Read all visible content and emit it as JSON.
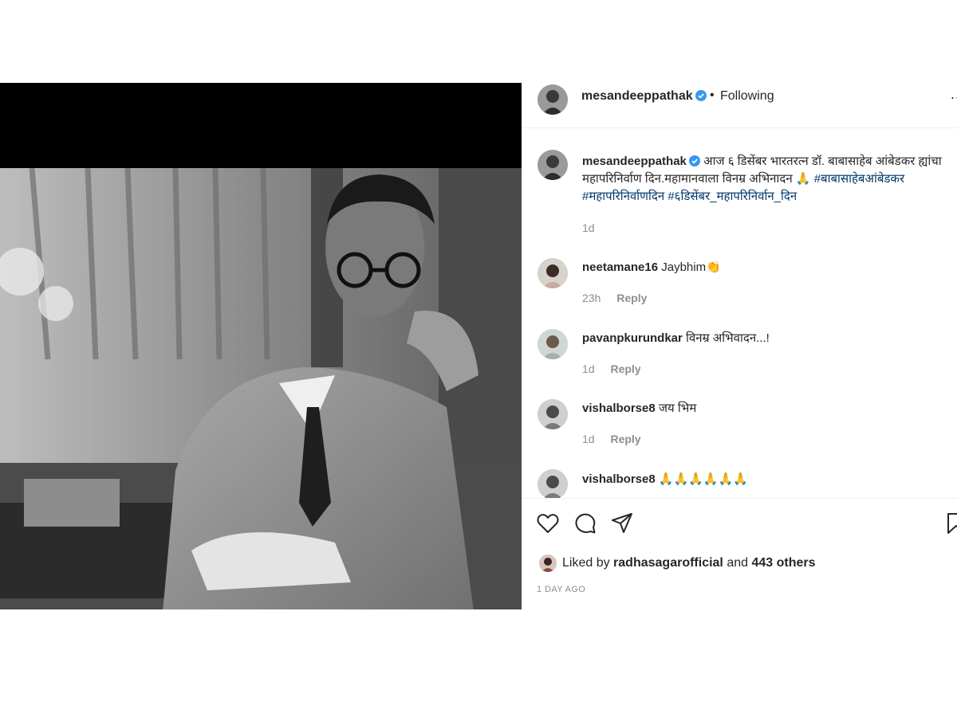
{
  "post": {
    "username": "mesandeeppathak",
    "follow_status": "Following",
    "separator": "•",
    "more_label": "..."
  },
  "caption": {
    "username": "mesandeeppathak",
    "text": "आज ६ डिसेंबर भारतरत्न डॉ. बाबासाहेब आंबेडकर ह्यांचा महापरिनिर्वाण दिन.महामानवाला विनम्र अभिनादन 🙏",
    "hashtags": "#बाबासाहेबआंबेडकर #महापरिनिर्वाणदिन #६डिसेंबर_महापरिनिर्वान_दिन",
    "time": "1d"
  },
  "comments": [
    {
      "username": "neetamane16",
      "text": "Jaybhim👏",
      "time": "23h",
      "reply_label": "Reply"
    },
    {
      "username": "pavanpkurundkar",
      "text": "विनम्र अभिवादन...!",
      "time": "1d",
      "reply_label": "Reply"
    },
    {
      "username": "vishalborse8",
      "text": "जय भिम",
      "time": "1d",
      "reply_label": "Reply"
    },
    {
      "username": "vishalborse8",
      "text": "🙏🙏🙏🙏🙏🙏",
      "time": "",
      "reply_label": ""
    }
  ],
  "likes": {
    "prefix": "Liked by",
    "user": "radhasagarofficial",
    "joiner": "and",
    "others": "443 others"
  },
  "post_date": "1 DAY AGO",
  "icons": {
    "verified": "verified-badge-icon",
    "like": "heart-icon",
    "comment": "comment-bubble-icon",
    "share": "paper-plane-icon",
    "save": "bookmark-icon"
  },
  "colors": {
    "verified": "#3897f0",
    "hashtag": "#00376b",
    "muted": "#8e8e8e",
    "text": "#262626"
  }
}
